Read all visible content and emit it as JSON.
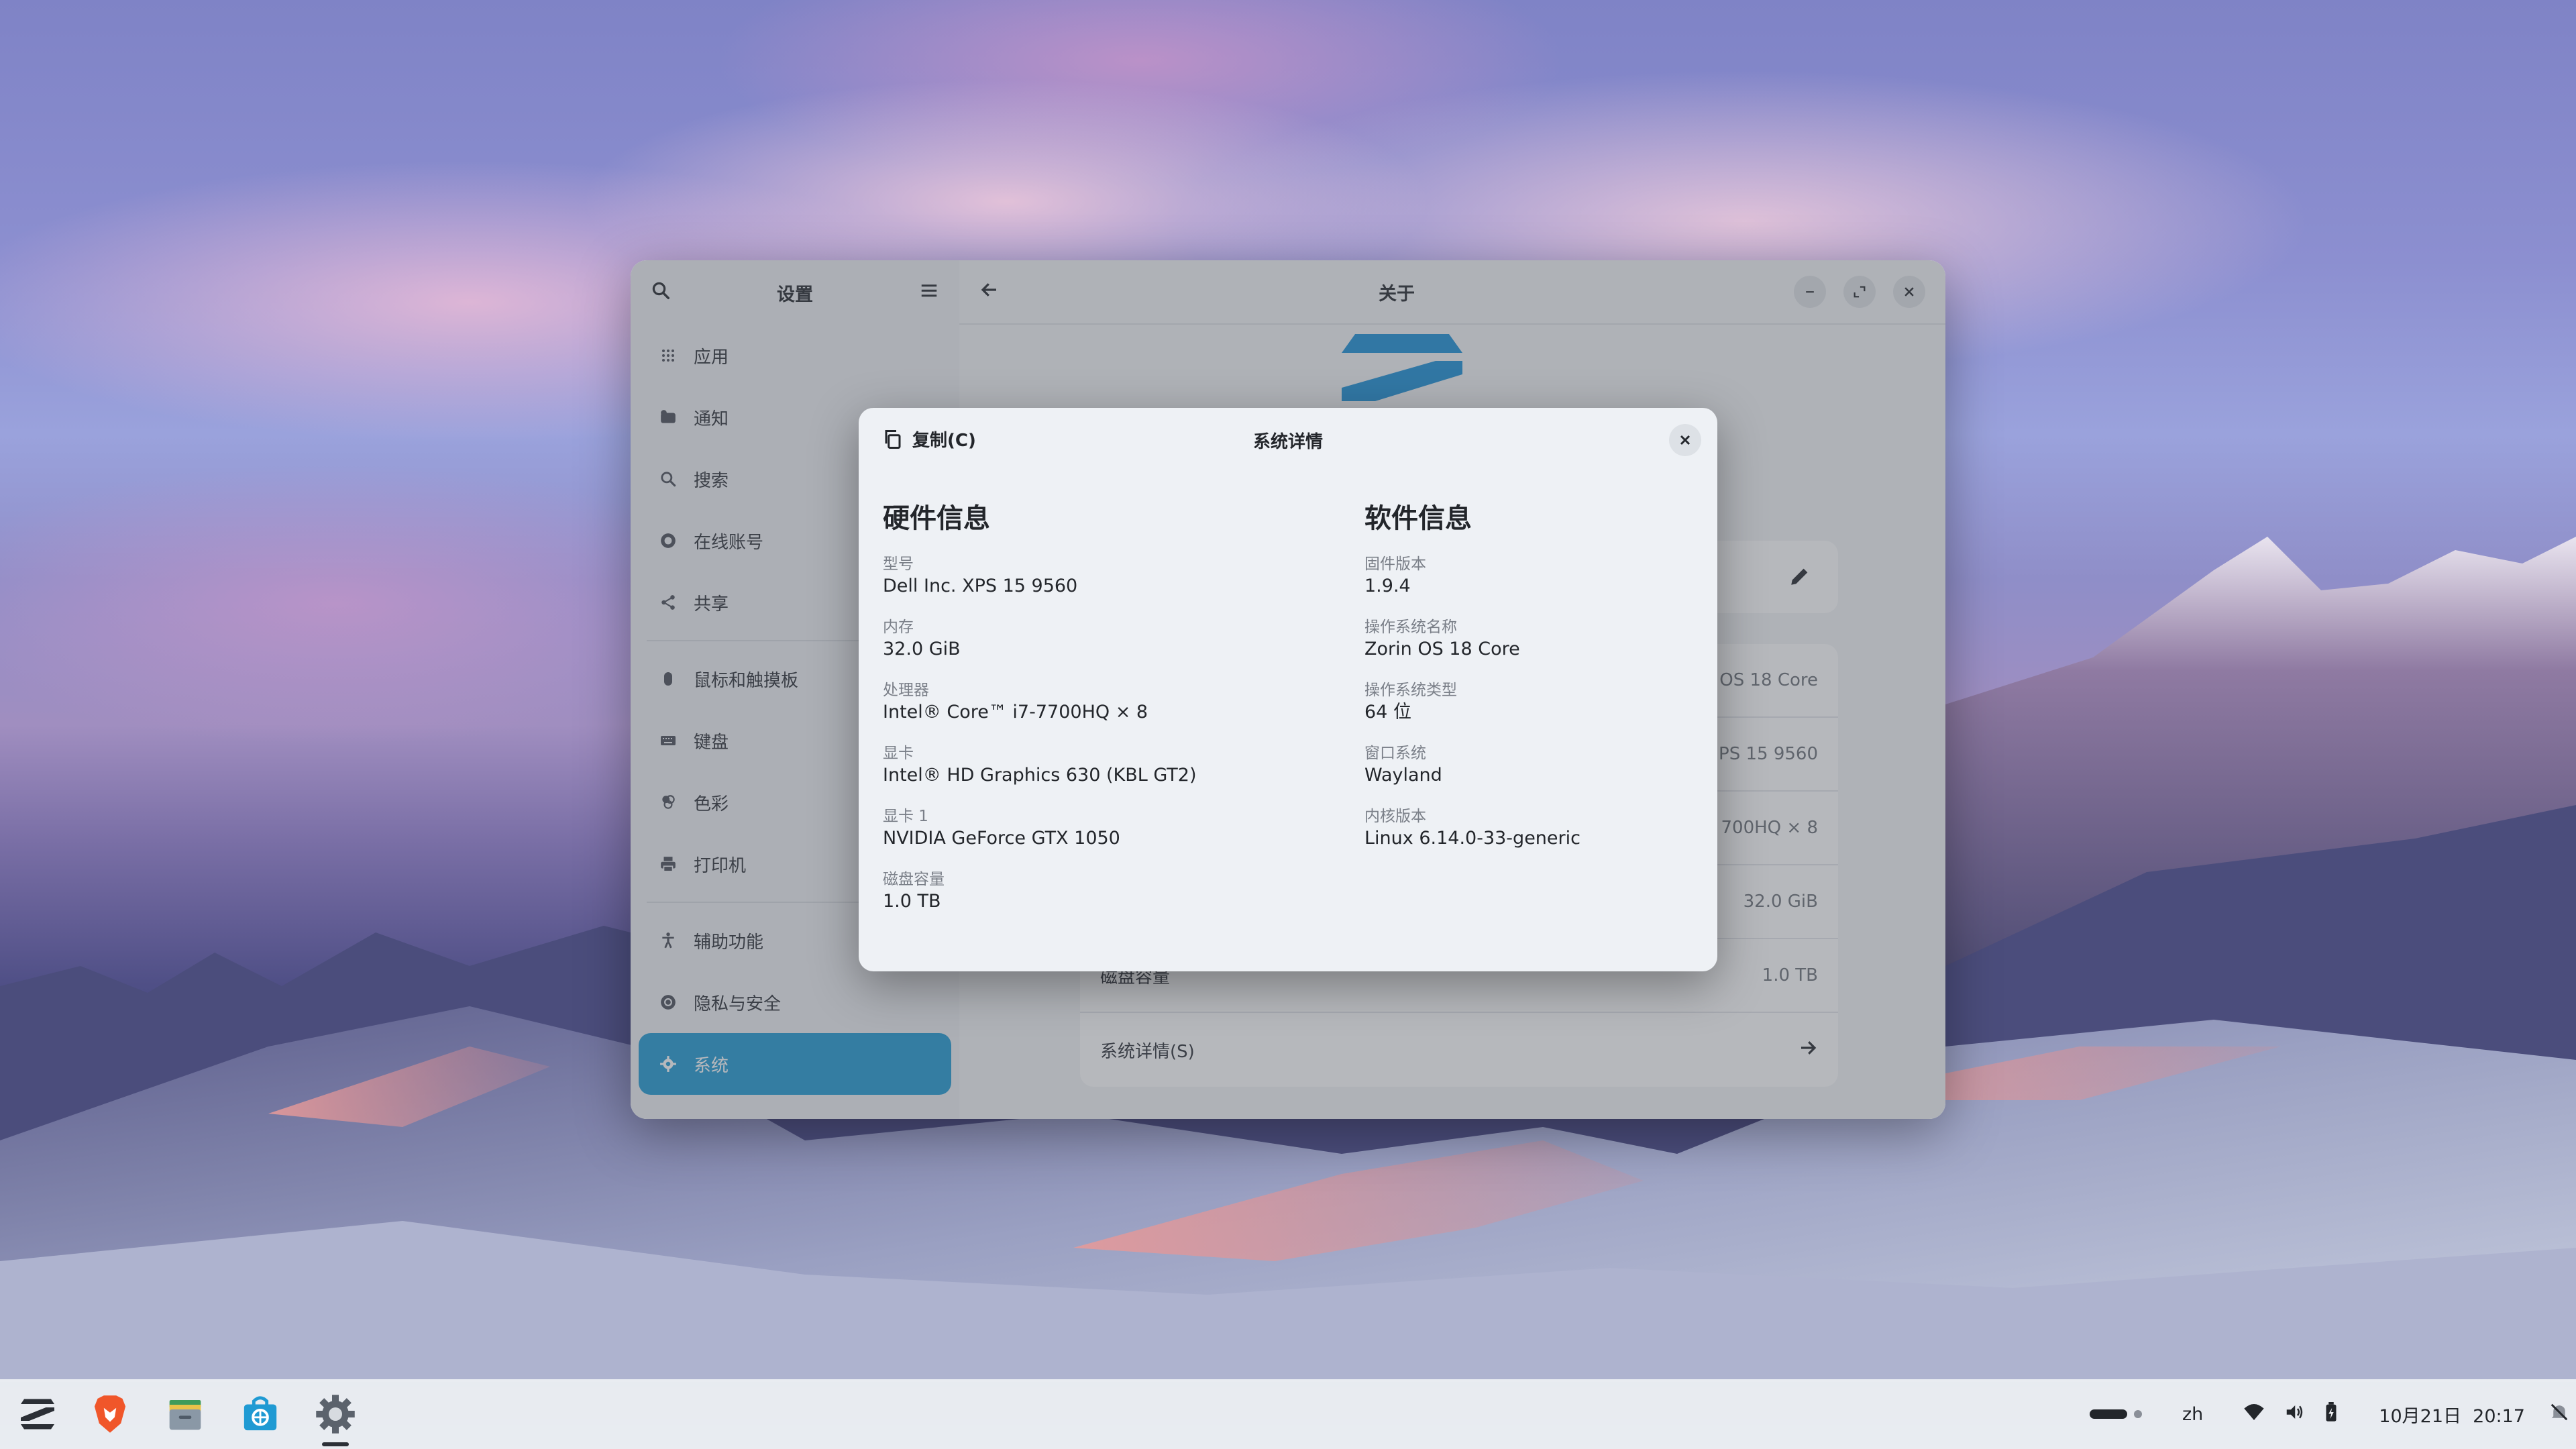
{
  "settings": {
    "sidebar_title": "设置",
    "content_title": "关于",
    "sidebar_items": [
      {
        "label": "应用",
        "icon": "apps-grid-icon"
      },
      {
        "label": "通知",
        "icon": "notification-icon"
      },
      {
        "label": "搜索",
        "icon": "search-icon"
      },
      {
        "label": "在线账号",
        "icon": "online-accounts-icon"
      },
      {
        "label": "共享",
        "icon": "share-icon"
      },
      {
        "label": "鼠标和触摸板",
        "icon": "mouse-icon"
      },
      {
        "label": "键盘",
        "icon": "keyboard-icon"
      },
      {
        "label": "色彩",
        "icon": "color-icon"
      },
      {
        "label": "打印机",
        "icon": "printer-icon"
      },
      {
        "label": "辅助功能",
        "icon": "accessibility-icon"
      },
      {
        "label": "隐私与安全",
        "icon": "privacy-icon"
      },
      {
        "label": "系统",
        "icon": "gear-icon"
      }
    ],
    "about_rows": [
      {
        "label": "",
        "value": "OS 18 Core"
      },
      {
        "label": "",
        "value": "PS 15 9560"
      },
      {
        "label": "",
        "value": "700HQ × 8"
      },
      {
        "label": "",
        "value": "32.0 GiB"
      },
      {
        "label": "磁盘容量",
        "value": "1.0 TB"
      }
    ],
    "system_details_label": "系统详情(S)"
  },
  "dialog": {
    "copy_label": "复制(C)",
    "title": "系统详情",
    "hardware": {
      "heading": "硬件信息",
      "fields": [
        {
          "key": "型号",
          "value": "Dell Inc. XPS 15 9560"
        },
        {
          "key": "内存",
          "value": "32.0 GiB"
        },
        {
          "key": "处理器",
          "value": "Intel® Core™ i7-7700HQ × 8"
        },
        {
          "key": "显卡",
          "value": "Intel® HD Graphics 630 (KBL GT2)"
        },
        {
          "key": "显卡 1",
          "value": "NVIDIA GeForce GTX 1050"
        },
        {
          "key": "磁盘容量",
          "value": "1.0 TB"
        }
      ]
    },
    "software": {
      "heading": "软件信息",
      "fields": [
        {
          "key": "固件版本",
          "value": "1.9.4"
        },
        {
          "key": "操作系统名称",
          "value": "Zorin OS 18 Core"
        },
        {
          "key": "操作系统类型",
          "value": "64 位"
        },
        {
          "key": "窗口系统",
          "value": "Wayland"
        },
        {
          "key": "内核版本",
          "value": "Linux 6.14.0-33-generic"
        }
      ]
    }
  },
  "taskbar": {
    "language": "zh",
    "clock": "10月21日  20:17"
  },
  "colors": {
    "accent": "#1f9ad3",
    "zorin_blue": "#1a8fd6"
  }
}
